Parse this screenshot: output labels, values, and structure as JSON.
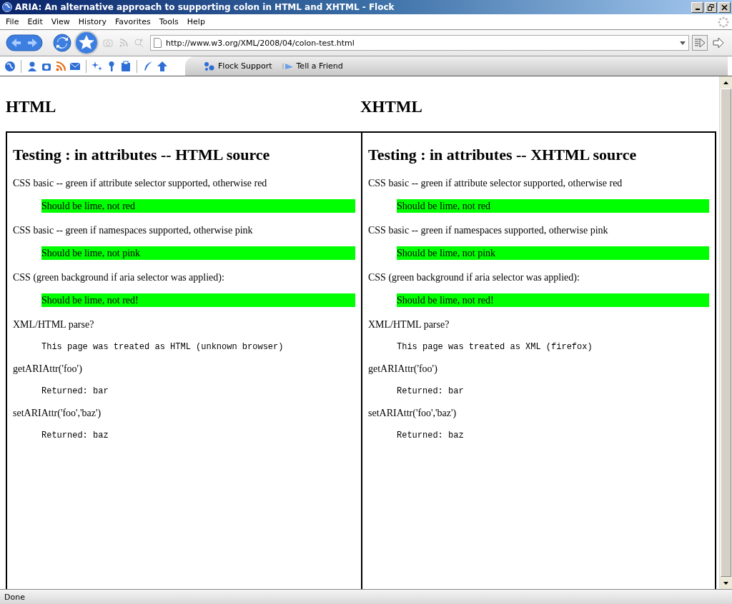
{
  "window": {
    "title": "ARIA: An alternative approach to supporting colon in HTML and XHTML - Flock"
  },
  "menu": [
    "File",
    "Edit",
    "View",
    "History",
    "Favorites",
    "Tools",
    "Help"
  ],
  "toolbar": {
    "url": "http://www.w3.org/XML/2008/04/colon-test.html"
  },
  "bookmarks": [
    "Flock Support",
    "Tell a Friend"
  ],
  "page": {
    "columns": [
      {
        "heading": "HTML",
        "title": "Testing : in attributes -- HTML source",
        "items": [
          {
            "kind": "label",
            "text": "CSS basic -- green if attribute selector supported, otherwise red"
          },
          {
            "kind": "swatch",
            "text": "Should be lime, not red"
          },
          {
            "kind": "label",
            "text": "CSS basic -- green if namespaces supported, otherwise pink"
          },
          {
            "kind": "swatch",
            "text": "Should be lime, not pink"
          },
          {
            "kind": "label",
            "text": "CSS (green background if aria selector was applied):"
          },
          {
            "kind": "swatch",
            "text": "Should be lime, not red!"
          },
          {
            "kind": "label",
            "text": "XML/HTML parse?"
          },
          {
            "kind": "code",
            "text": "This page was treated as HTML (unknown browser)"
          },
          {
            "kind": "label",
            "text": "getARIAttr('foo')"
          },
          {
            "kind": "code",
            "text": "Returned: bar"
          },
          {
            "kind": "label",
            "text": "setARIAttr('foo','baz')"
          },
          {
            "kind": "code",
            "text": "Returned: baz"
          }
        ]
      },
      {
        "heading": "XHTML",
        "title": "Testing : in attributes -- XHTML source",
        "items": [
          {
            "kind": "label",
            "text": "CSS basic -- green if attribute selector supported, otherwise red"
          },
          {
            "kind": "swatch",
            "text": "Should be lime, not red"
          },
          {
            "kind": "label",
            "text": "CSS basic -- green if namespaces supported, otherwise pink"
          },
          {
            "kind": "swatch",
            "text": "Should be lime, not pink"
          },
          {
            "kind": "label",
            "text": "CSS (green background if aria selector was applied):"
          },
          {
            "kind": "swatch",
            "text": "Should be lime, not red!"
          },
          {
            "kind": "label",
            "text": "XML/HTML parse?"
          },
          {
            "kind": "code",
            "text": "This page was treated as XML (firefox)"
          },
          {
            "kind": "label",
            "text": "getARIAttr('foo')"
          },
          {
            "kind": "code",
            "text": "Returned: bar"
          },
          {
            "kind": "label",
            "text": "setARIAttr('foo','baz')"
          },
          {
            "kind": "code",
            "text": "Returned: baz"
          }
        ]
      }
    ]
  },
  "status_bar": "Done"
}
